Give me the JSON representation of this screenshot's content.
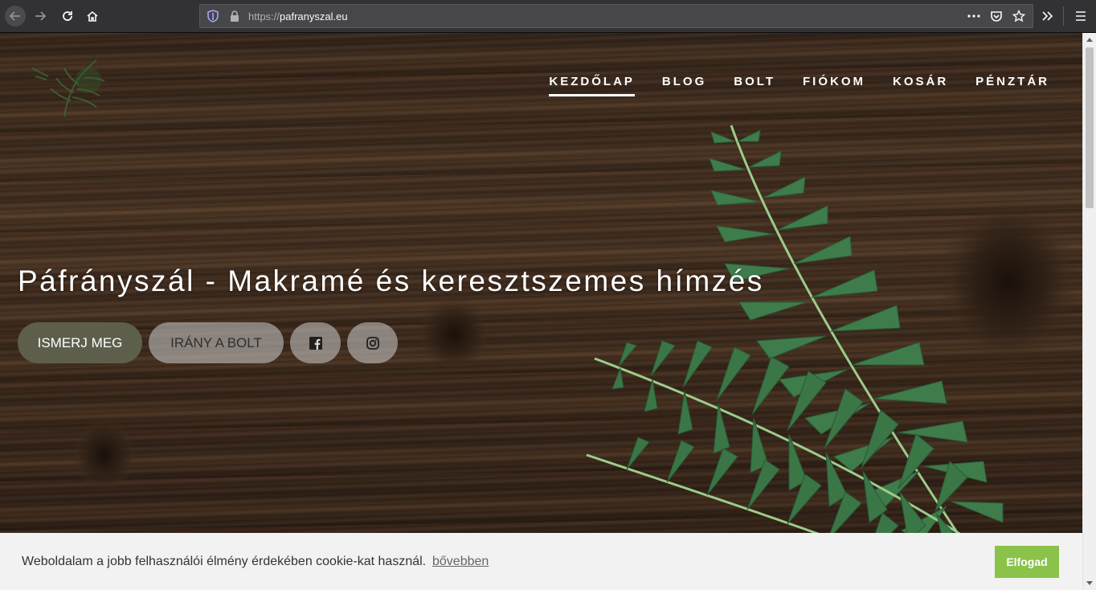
{
  "browser": {
    "url_protocol": "https://",
    "url_host": "pafranyszal.eu",
    "icons": [
      "back-icon",
      "forward-icon",
      "reload-icon",
      "home-icon",
      "shield-icon",
      "lock-icon",
      "more-icon",
      "pocket-icon",
      "bookmark-star-icon",
      "overflow-icon",
      "menu-icon"
    ]
  },
  "nav": {
    "items": [
      {
        "label": "KEZDŐLAP",
        "active": true
      },
      {
        "label": "BLOG"
      },
      {
        "label": "BOLT"
      },
      {
        "label": "FIÓKOM"
      },
      {
        "label": "KOSÁR"
      },
      {
        "label": "PÉNZTÁR"
      }
    ]
  },
  "hero": {
    "title": "Páfrányszál - Makramé és keresztszemes hímzés",
    "primary_button": "ISMERJ MEG",
    "secondary_button": "IRÁNY A BOLT"
  },
  "cookie": {
    "message": "Weboldalam a jobb felhasználói élmény érdekében cookie-kat használ.",
    "link": "bővebben",
    "accept": "Elfogad"
  },
  "colors": {
    "accent_green": "#8bc34a",
    "primary_btn": "#5d5f4c"
  }
}
